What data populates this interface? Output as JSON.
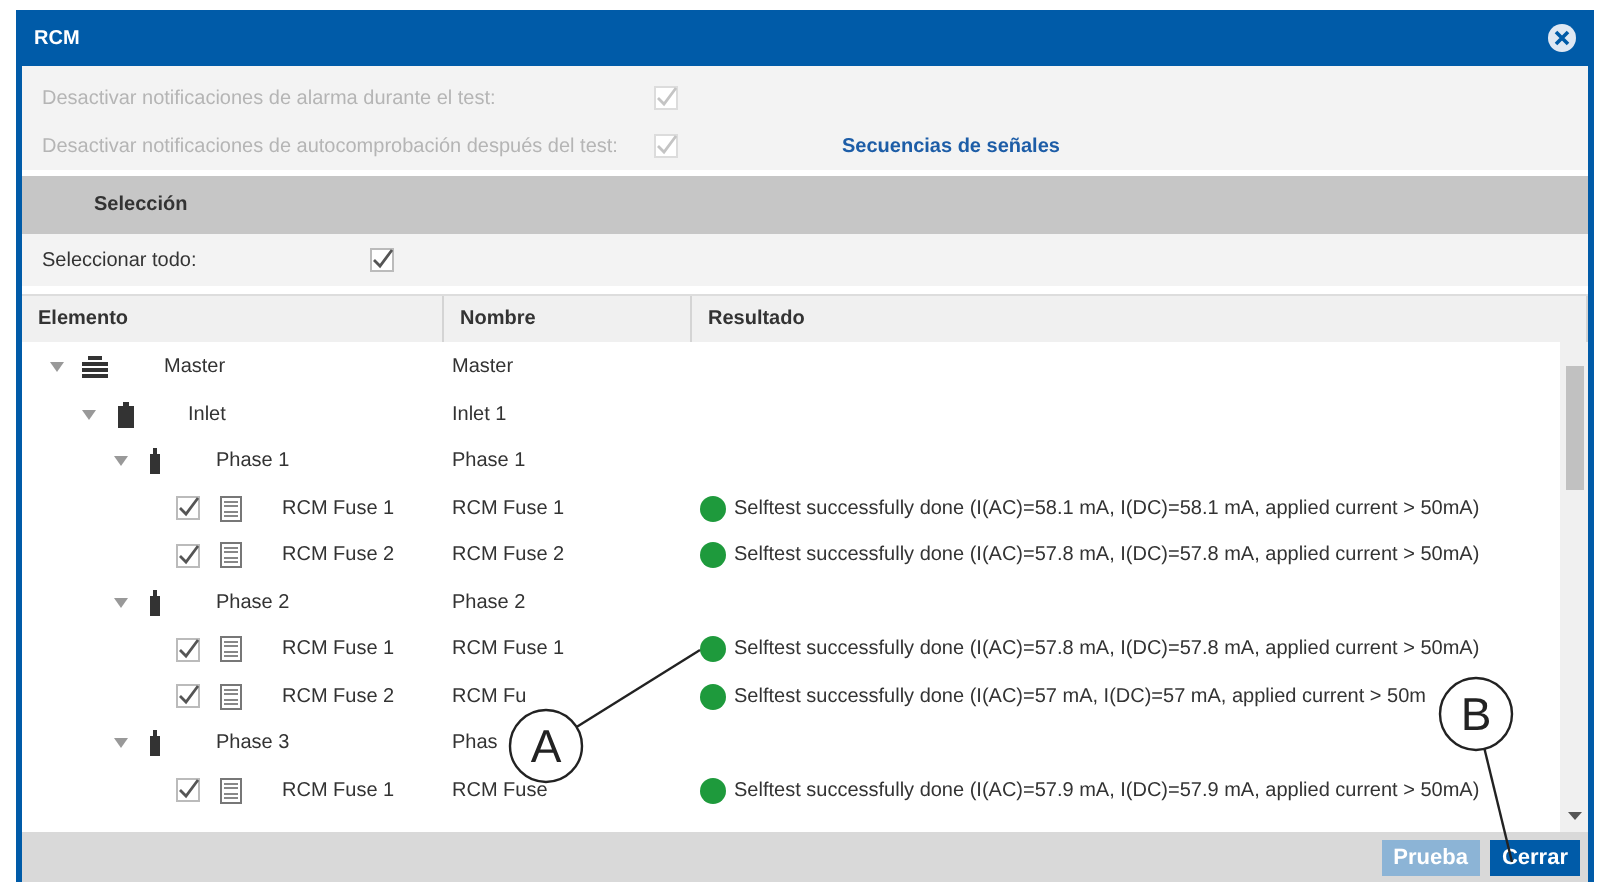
{
  "window": {
    "title": "RCM"
  },
  "options": [
    {
      "label": "Desactivar notificaciones de alarma durante el test:",
      "checked": true,
      "disabled": true
    },
    {
      "label": "Desactivar notificaciones de autocomprobación después del test:",
      "checked": true,
      "disabled": true
    }
  ],
  "link": "Secuencias de señales",
  "section": "Selección",
  "select_all": {
    "label": "Seleccionar todo:",
    "checked": true
  },
  "table": {
    "columns": [
      "Elemento",
      "Nombre",
      "Resultado"
    ],
    "rows": [
      {
        "kind": "master",
        "element": "Master",
        "name": "Master",
        "expanded": true,
        "children": [
          {
            "kind": "inlet",
            "element": "Inlet",
            "name": "Inlet 1",
            "expanded": true,
            "children": [
              {
                "kind": "phase",
                "element": "Phase 1",
                "name": "Phase 1",
                "expanded": true,
                "children": [
                  {
                    "kind": "fuse",
                    "element": "RCM Fuse 1",
                    "name": "RCM Fuse 1",
                    "checked": true,
                    "color": "#1e9a3c",
                    "result": "Selftest successfully done (I(AC)=58.1 mA, I(DC)=58.1 mA, applied current > 50mA)"
                  },
                  {
                    "kind": "fuse",
                    "element": "RCM Fuse 2",
                    "name": "RCM Fuse 2",
                    "checked": true,
                    "color": "#1e9a3c",
                    "result": "Selftest successfully done (I(AC)=57.8 mA, I(DC)=57.8 mA, applied current > 50mA)"
                  }
                ]
              },
              {
                "kind": "phase",
                "element": "Phase 2",
                "name": "Phase 2",
                "expanded": true,
                "children": [
                  {
                    "kind": "fuse",
                    "element": "RCM Fuse 1",
                    "name": "RCM Fuse 1",
                    "checked": true,
                    "color": "#1e9a3c",
                    "result": "Selftest successfully done (I(AC)=57.8 mA, I(DC)=57.8 mA, applied current > 50mA)"
                  },
                  {
                    "kind": "fuse",
                    "element": "RCM Fuse 2",
                    "name": "RCM Fu",
                    "checked": true,
                    "color": "#1e9a3c",
                    "result": "Selftest successfully done (I(AC)=57 mA, I(DC)=57 mA, applied current > 50m"
                  }
                ]
              },
              {
                "kind": "phase",
                "element": "Phase 3",
                "name": "Phas",
                "expanded": true,
                "children": [
                  {
                    "kind": "fuse",
                    "element": "RCM Fuse 1",
                    "name": "RCM Fuse",
                    "checked": true,
                    "color": "#1e9a3c",
                    "result": "Selftest successfully done (I(AC)=57.9 mA, I(DC)=57.9 mA, applied current > 50mA)"
                  }
                ]
              }
            ]
          }
        ]
      }
    ]
  },
  "buttons": [
    {
      "label": "Prueba",
      "disabled": true
    },
    {
      "label": "Cerrar",
      "disabled": false
    }
  ],
  "callouts": [
    {
      "label": "A"
    },
    {
      "label": "B"
    }
  ]
}
